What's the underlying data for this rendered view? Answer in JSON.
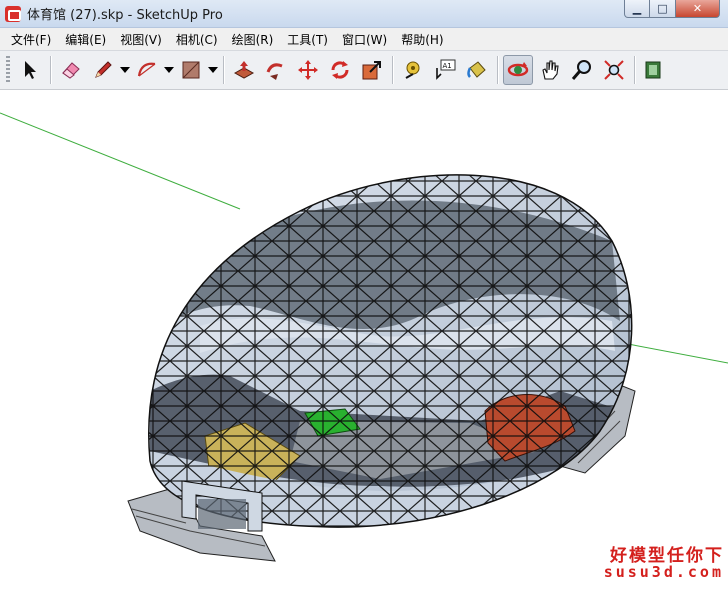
{
  "window": {
    "title": "体育馆 (27).skp - SketchUp Pro",
    "controls": {
      "minimize": "▁",
      "maximize": "□",
      "close": "✕"
    }
  },
  "menu": {
    "items": [
      "文件(F)",
      "编辑(E)",
      "视图(V)",
      "相机(C)",
      "绘图(R)",
      "工具(T)",
      "窗口(W)",
      "帮助(H)"
    ]
  },
  "toolbar": {
    "tools": [
      {
        "icon": "select-arrow-icon"
      },
      {
        "icon": "eraser-icon"
      },
      {
        "icon": "pencil-line-icon",
        "dropdown": true
      },
      {
        "icon": "arc-icon",
        "dropdown": true
      },
      {
        "icon": "rectangle-icon",
        "dropdown": true
      },
      {
        "icon": "push-pull-icon"
      },
      {
        "icon": "follow-me-icon"
      },
      {
        "icon": "move-icon"
      },
      {
        "icon": "rotate-icon"
      },
      {
        "icon": "scale-icon"
      },
      {
        "icon": "tape-measure-icon"
      },
      {
        "icon": "text-label-icon",
        "label": "A1"
      },
      {
        "icon": "paint-bucket-icon"
      },
      {
        "icon": "orbit-icon",
        "active": true
      },
      {
        "icon": "pan-hand-icon"
      },
      {
        "icon": "zoom-icon"
      },
      {
        "icon": "zoom-extents-icon"
      },
      {
        "icon": "warehouse-icon"
      }
    ]
  },
  "colors": {
    "axis_green": "#3fae3f",
    "dome_glass": "#c9d6e6",
    "dome_dark": "#5b6673",
    "red_seats": "#b94a2e",
    "yellow_seats": "#c9b25a",
    "green_court": "#29b12f",
    "watermark_red": "#d4201d"
  },
  "watermark": {
    "line1": "好模型任你下",
    "line2": "susu3d.com"
  }
}
